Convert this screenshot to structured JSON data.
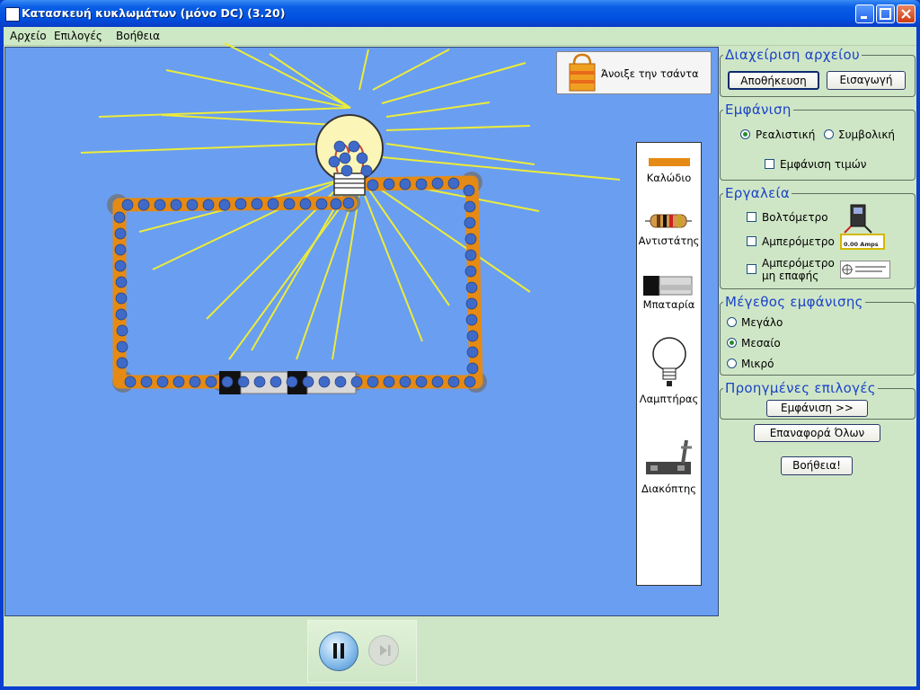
{
  "window": {
    "title": "Κατασκευή κυκλωμάτων (μόνο DC) (3.20)"
  },
  "menu": [
    "Αρχείο",
    "Επιλογές",
    "Βοήθεια"
  ],
  "bag_button": {
    "label": "Άνοιξε την τσάντα"
  },
  "toolbox": [
    {
      "label": "Καλώδιο",
      "icon": "wire-icon"
    },
    {
      "label": "Αντιστάτης",
      "icon": "resistor-icon"
    },
    {
      "label": "Μπαταρία",
      "icon": "battery-icon"
    },
    {
      "label": "Λαμπτήρας",
      "icon": "bulb-icon"
    },
    {
      "label": "Διακόπτης",
      "icon": "switch-icon"
    }
  ],
  "file_panel": {
    "title": "Διαχείριση αρχείου",
    "save_label": "Αποθήκευση",
    "load_label": "Εισαγωγή"
  },
  "view_panel": {
    "title": "Εμφάνιση",
    "options": [
      {
        "label": "Ρεαλιστική",
        "selected": true
      },
      {
        "label": "Συμβολική",
        "selected": false
      }
    ],
    "show_values_label": "Εμφάνιση τιμών",
    "show_values_checked": false
  },
  "tools_panel": {
    "title": "Εργαλεία",
    "items": [
      {
        "label": "Βολτόμετρο",
        "checked": false
      },
      {
        "label": "Αμπερόμετρο",
        "checked": false
      },
      {
        "label": "Αμπερόμετρο μη επαφής",
        "line1": "Αμπερόμετρο",
        "line2": "μη επαφής",
        "checked": false
      }
    ],
    "ammeter_readout": "0.00 Amps"
  },
  "size_panel": {
    "title": "Μέγεθος εμφάνισης",
    "options": [
      {
        "label": "Μεγάλο",
        "selected": false
      },
      {
        "label": "Μεσαίο",
        "selected": true
      },
      {
        "label": "Μικρό",
        "selected": false
      }
    ]
  },
  "advanced_panel": {
    "title": "Προηγμένες επιλογές",
    "show_label": "Εμφάνιση >>"
  },
  "reset_label": "Επαναφορά Όλων",
  "help_label": "Βοήθεια!",
  "colors": {
    "playarea": "#6a9ef0",
    "frame": "#cfe6c6",
    "wire": "#e58a14",
    "electron": "#3f6ac8",
    "ray": "#ecec3a"
  }
}
